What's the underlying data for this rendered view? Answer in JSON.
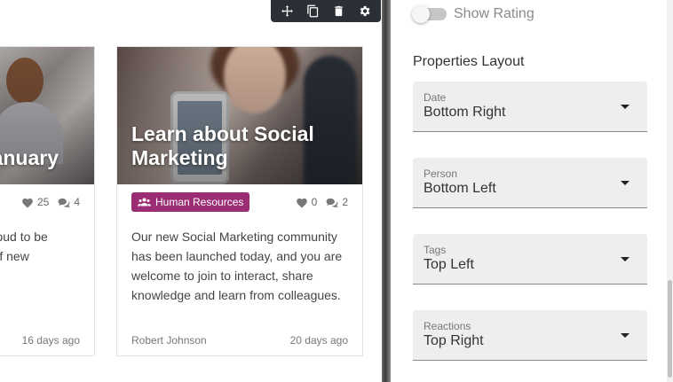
{
  "toolbar": {
    "icons": [
      "move-icon",
      "duplicate-icon",
      "delete-icon",
      "settings-icon"
    ]
  },
  "cards": [
    {
      "title": "January",
      "likes": "25",
      "comments": "4",
      "body_lines": [
        "proud to be",
        "r of new"
      ],
      "time": "16 days ago"
    },
    {
      "title_line1": "Learn about Social",
      "title_line2": "Marketing",
      "tag": "Human Resources",
      "likes": "0",
      "comments": "2",
      "body": "Our new Social Marketing community has been launched today, and you are welcome to join to interact, share knowledge and learn from colleagues.",
      "author": "Robert Johnson",
      "time": "20 days ago"
    }
  ],
  "panel": {
    "toggle_label": "Show Rating",
    "toggle_on": false,
    "section_title": "Properties Layout",
    "selects": [
      {
        "label": "Date",
        "value": "Bottom Right"
      },
      {
        "label": "Person",
        "value": "Bottom Left"
      },
      {
        "label": "Tags",
        "value": "Top Left"
      },
      {
        "label": "Reactions",
        "value": "Top Right"
      }
    ]
  },
  "colors": {
    "tag_bg": "#9b2d74",
    "toolbar_bg": "#2b3037",
    "select_bg": "#eeeeee"
  }
}
